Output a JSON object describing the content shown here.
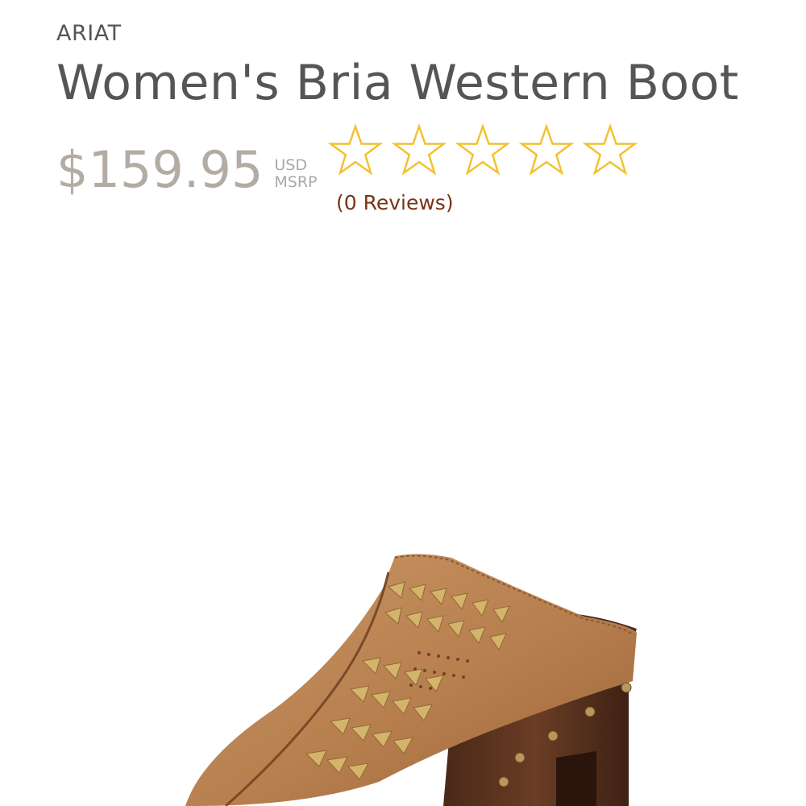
{
  "product": {
    "brand": "ARIAT",
    "title": "Women's Bria Western Boot",
    "price": "$159.95",
    "currency": "USD",
    "price_type": "MSRP",
    "rating": {
      "value": 0,
      "max": 5,
      "reviews_label": "(0 Reviews)",
      "star_icon": "star-outline-icon",
      "star_color": "#f2c12e"
    },
    "image": {
      "icon": "mule-clog-image",
      "leather_color": "#b77f4e",
      "heel_color": "#5a3320",
      "weave_color": "#d4b46a"
    }
  },
  "colors": {
    "text": "#555555",
    "price": "#b3aca2",
    "review_link": "#7a3316"
  }
}
